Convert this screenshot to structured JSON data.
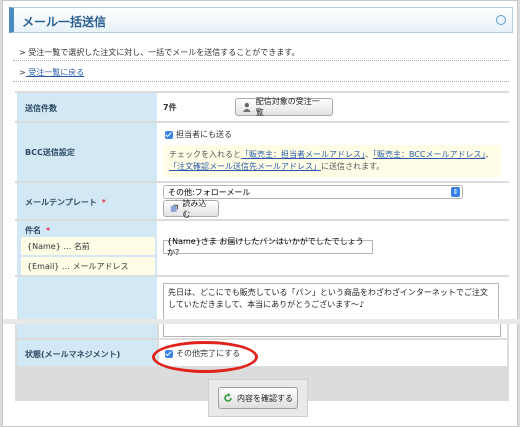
{
  "title": "メール一括送信",
  "intro": "受注一覧で選択した注文に対し、一括でメールを送信することができます。",
  "back_link": "受注一覧に戻る",
  "rows": {
    "send_count": {
      "label": "送信件数",
      "value": "7件",
      "button": "配信対象の受注一覧"
    },
    "bcc": {
      "label": "BCC送信設定",
      "checkbox_label": "担当者にも送る",
      "note_prefix": "チェックを入れると",
      "link1": "「販売主：担当者メールアドレス」",
      "sep1": "、",
      "link2": "「販売主：BCCメールアドレス」",
      "sep2": "、",
      "link3": "「注文確認メール送信先メールアドレス」",
      "note_suffix": "に送信されます。"
    },
    "template": {
      "label": "メールテンプレート",
      "required": "*",
      "select_value": "その他:フォローメール",
      "load_button": "読み込む"
    },
    "subject": {
      "label": "件名",
      "required": "*",
      "vars": [
        "{Name} … 名前",
        "{Email} … メールアドレス"
      ],
      "value": "{Name}さま お届けしたパンはいかがでしたでしょうか？"
    },
    "body": {
      "text": "先日は、どこにでも販売している「パン」という商品をわざわざインターネットでご注文していただきまして、本当にありがとうございます〜♪"
    },
    "status": {
      "label": "状態(メールマネジメント)",
      "checkbox_label": "その他完了にする"
    }
  },
  "confirm_button": "内容を確認する",
  "colors": {
    "accent": "#4a8bc0",
    "label_bg": "#d3e8f5",
    "highlight": "#e0221b"
  }
}
